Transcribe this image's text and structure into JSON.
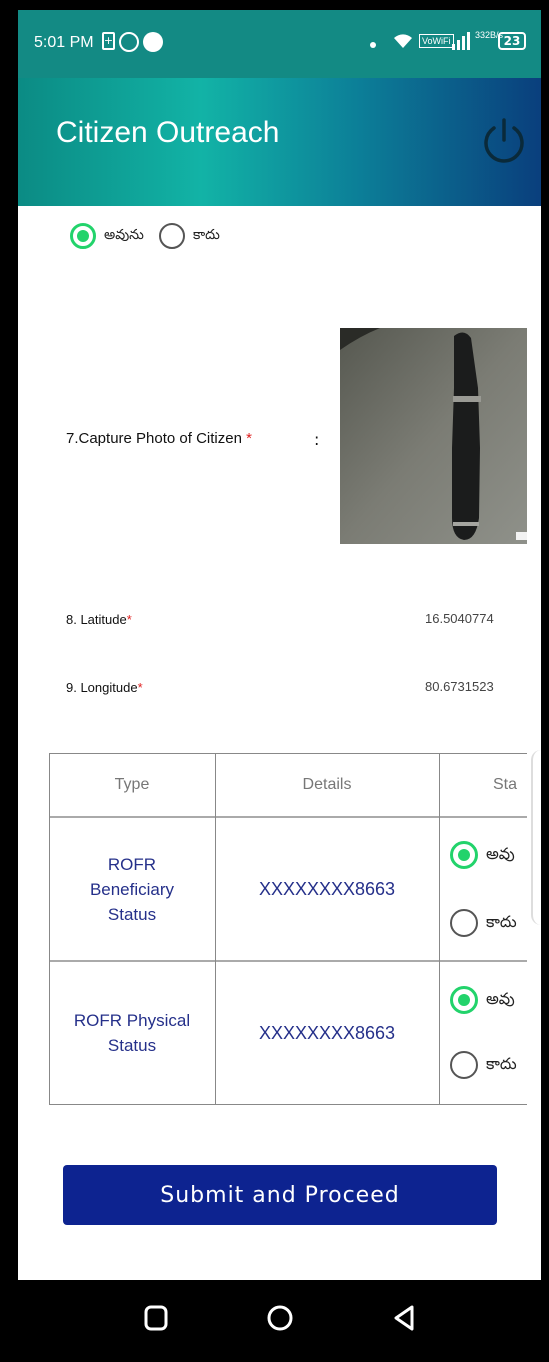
{
  "status_bar": {
    "time": "5:01 PM",
    "vowifi": "VoWiFi",
    "speed_top": "332",
    "speed_bottom": "B/s",
    "battery": "23"
  },
  "header": {
    "title": "Citizen Outreach",
    "power_icon": "power-icon"
  },
  "top_radio": {
    "yes_label": "అవును",
    "no_label": "కాదు",
    "selected": "yes"
  },
  "photo_field": {
    "label": "7.Capture Photo of Citizen",
    "required_mark": "*",
    "colon": ":"
  },
  "latitude": {
    "label": "8. Latitude",
    "required_mark": "*",
    "value": "16.5040774"
  },
  "longitude": {
    "label": "9. Longitude",
    "required_mark": "*",
    "value": "80.6731523"
  },
  "table": {
    "headers": [
      "Type",
      "Details",
      "Sta"
    ],
    "rows": [
      {
        "type_line1": "ROFR",
        "type_line2": "Beneficiary",
        "type_line3": "Status",
        "details": "XXXXXXXX8663",
        "yes_label": "అవు",
        "no_label": "కాదు",
        "selected": "yes"
      },
      {
        "type_line1": "ROFR Physical",
        "type_line2": "Status",
        "details": "XXXXXXXX8663",
        "yes_label": "అవు",
        "no_label": "కాదు",
        "selected": "yes"
      }
    ]
  },
  "submit": {
    "label": "Submit and Proceed"
  },
  "colors": {
    "accent_green": "#22d36b",
    "submit_blue": "#0d2390",
    "header_teal": "#12b3a6",
    "required_red": "#e01e1e"
  }
}
